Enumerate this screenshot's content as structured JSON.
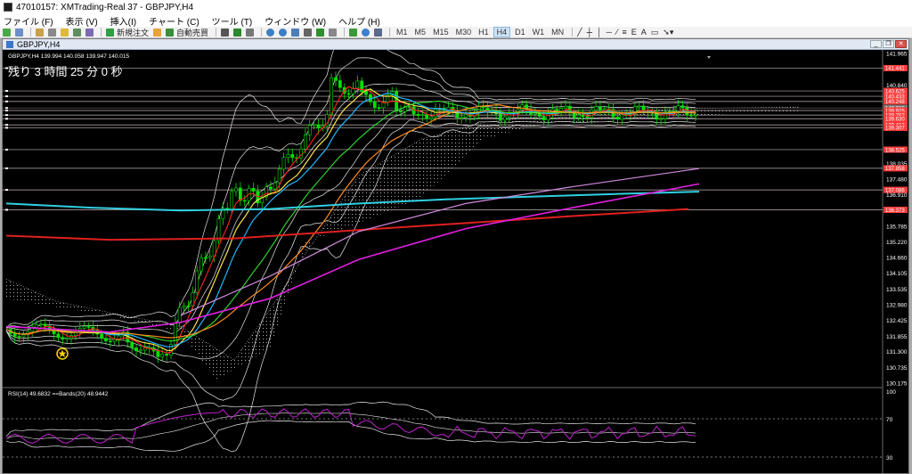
{
  "window": {
    "title": "47010157: XMTrading-Real 37 - GBPJPY,H4"
  },
  "menu": [
    "ファイル (F)",
    "表示 (V)",
    "挿入(I)",
    "チャート (C)",
    "ツール (T)",
    "ウィンドウ (W)",
    "ヘルプ (H)"
  ],
  "toolbar": {
    "new_order": "新規注文",
    "auto_trade": "自動売買",
    "timeframes": [
      "M1",
      "M5",
      "M15",
      "M30",
      "H1",
      "H4",
      "D1",
      "W1",
      "MN"
    ],
    "active_timeframe": "H4"
  },
  "chart_window": {
    "tab": "GBPJPY,H4"
  },
  "chart": {
    "symbol_info": "GBPJPY,H4  139.994 140.058 139.947 140.015",
    "countdown": "残り 3 時間 25 分 0 秒",
    "rsi_label": "RSI(14) 49.6832  ==Bands(20) 48.9442",
    "price_axis": [
      "141.965",
      "140.840",
      "138.035",
      "137.480",
      "136.910",
      "135.785",
      "135.220",
      "134.660",
      "134.105",
      "133.535",
      "132.980",
      "132.425",
      "131.855",
      "131.300",
      "130.735",
      "130.175"
    ],
    "highlighted_prices": [
      {
        "label": "141.441",
        "price": 141.441,
        "color": "#ff3b3b"
      },
      {
        "label": "140.625",
        "price": 140.625,
        "color": "#ff3b3b"
      },
      {
        "label": "140.433",
        "price": 140.433,
        "color": "#ff3b3b"
      },
      {
        "label": "140.248",
        "price": 140.248,
        "color": "#ff3b3b"
      },
      {
        "label": "140.015",
        "price": 140.015,
        "color": "#7a7a7a"
      },
      {
        "label": "139.925",
        "price": 139.925,
        "color": "#ff3b3b"
      },
      {
        "label": "139.762",
        "price": 139.762,
        "color": "#ff3b3b"
      },
      {
        "label": "139.630",
        "price": 139.63,
        "color": "#ff3b3b"
      },
      {
        "label": "139.413",
        "price": 139.413,
        "color": "#ff3b3b"
      },
      {
        "label": "139.307",
        "price": 139.307,
        "color": "#ff3b3b"
      },
      {
        "label": "138.525",
        "price": 138.525,
        "color": "#ff3b3b"
      },
      {
        "label": "137.858",
        "price": 137.858,
        "color": "#ff3b3b"
      },
      {
        "label": "137.086",
        "price": 137.086,
        "color": "#ff3b3b"
      },
      {
        "label": "136.373",
        "price": 136.373,
        "color": "#ff3b3b"
      }
    ],
    "rsi_axis": [
      "100",
      "70",
      "30"
    ]
  }
}
